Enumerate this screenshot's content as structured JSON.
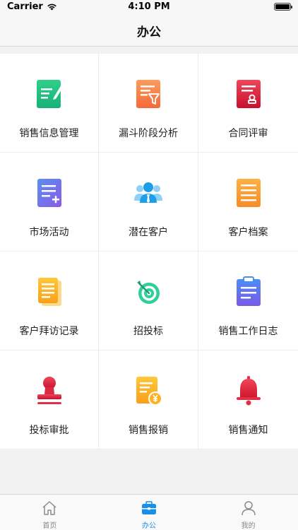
{
  "status_bar": {
    "carrier": "Carrier",
    "time": "4:10 PM"
  },
  "nav": {
    "title": "办公"
  },
  "grid": {
    "items": [
      {
        "label": "销售信息管理",
        "icon": "sales-info-icon"
      },
      {
        "label": "漏斗阶段分析",
        "icon": "funnel-analysis-icon"
      },
      {
        "label": "合同评审",
        "icon": "contract-review-icon"
      },
      {
        "label": "市场活动",
        "icon": "market-activity-icon"
      },
      {
        "label": "潜在客户",
        "icon": "potential-customer-icon"
      },
      {
        "label": "客户档案",
        "icon": "customer-file-icon"
      },
      {
        "label": "客户拜访记录",
        "icon": "visit-record-icon"
      },
      {
        "label": "招投标",
        "icon": "bidding-target-icon"
      },
      {
        "label": "销售工作日志",
        "icon": "work-log-icon"
      },
      {
        "label": "投标审批",
        "icon": "bid-approval-stamp-icon"
      },
      {
        "label": "销售报销",
        "icon": "reimbursement-icon"
      },
      {
        "label": "销售通知",
        "icon": "notification-bell-icon"
      }
    ]
  },
  "tab_bar": {
    "tabs": [
      {
        "label": "首页",
        "icon": "home-icon",
        "active": false
      },
      {
        "label": "办公",
        "icon": "briefcase-icon",
        "active": true
      },
      {
        "label": "我的",
        "icon": "profile-icon",
        "active": false
      }
    ]
  },
  "colors": {
    "accent": "#1a8fe8",
    "tab_inactive": "#888888"
  }
}
